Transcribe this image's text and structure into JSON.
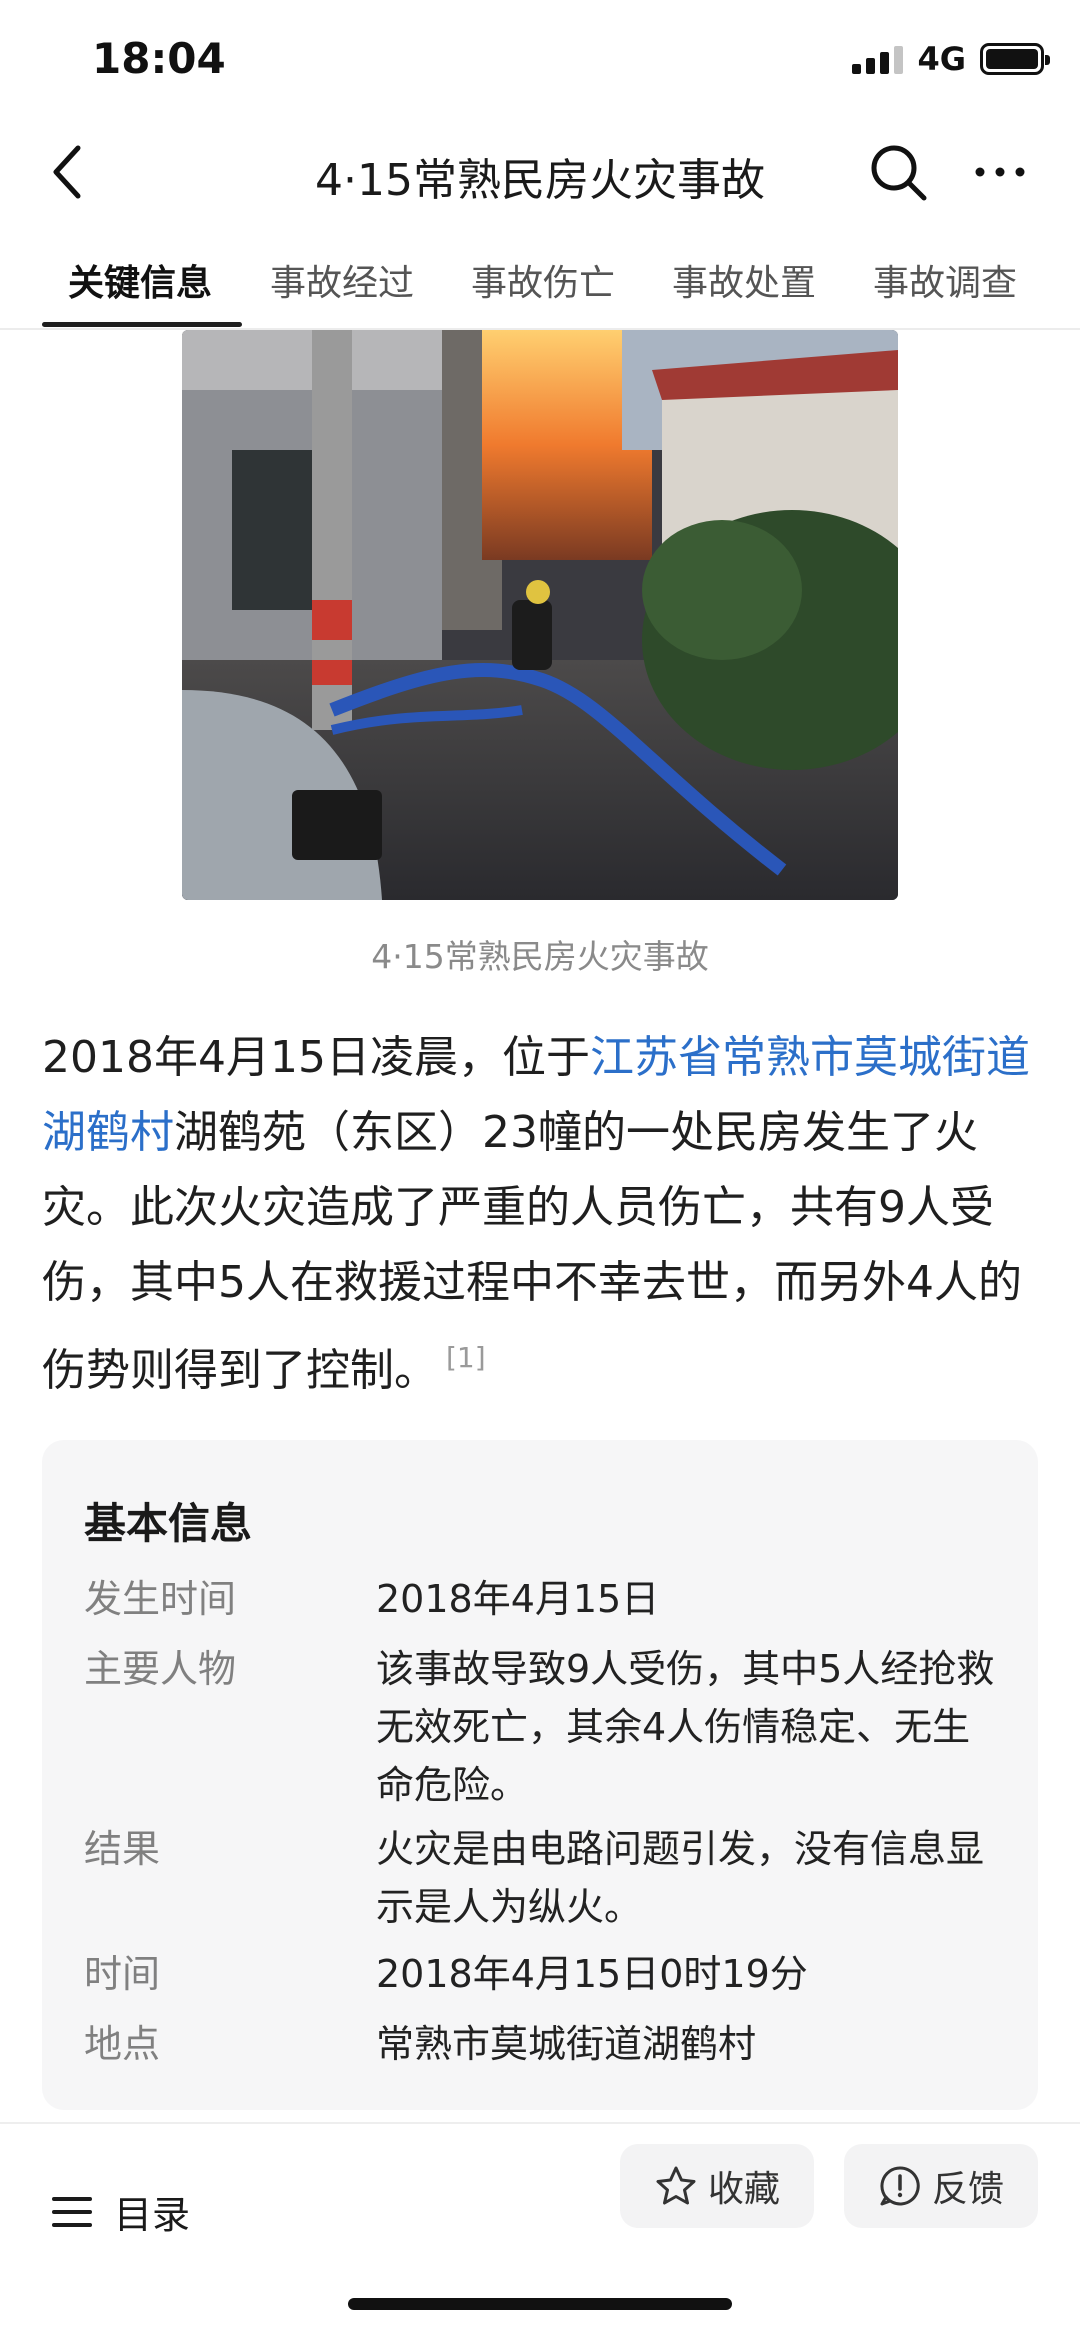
{
  "status": {
    "time": "18:04",
    "network": "4G"
  },
  "nav": {
    "title": "4·15常熟民房火灾事故",
    "tabs": [
      {
        "label": "关键信息",
        "active": true
      },
      {
        "label": "事故经过"
      },
      {
        "label": "事故伤亡"
      },
      {
        "label": "事故处置"
      },
      {
        "label": "事故调查"
      }
    ]
  },
  "image": {
    "caption": "4·15常熟民房火灾事故"
  },
  "intro": {
    "part1": "2018年4月15日凌晨，位于",
    "link": "江苏省常熟市莫城街道湖鹤村",
    "part2": "湖鹤苑（东区）23幢的一处民房发生了火灾。此次火灾造成了严重的人员伤亡，共有9人受伤，其中5人在救援过程中不幸去世，而另外4人的伤势则得到了控制。",
    "ref": "[1]"
  },
  "info": {
    "title": "基本信息",
    "rows": [
      {
        "key": "发生时间",
        "value": "2018年4月15日"
      },
      {
        "key": "主要人物",
        "value": "该事故导致9人受伤，其中5人经抢救无效死亡，其余4人伤情稳定、无生命危险。"
      },
      {
        "key": "结果",
        "value": "火灾是由电路问题引发，没有信息显示是人为纵火。"
      },
      {
        "key": "时间",
        "value": "2018年4月15日0时19分"
      },
      {
        "key": "地点",
        "value": "常熟市莫城街道湖鹤村"
      }
    ]
  },
  "bottom": {
    "toc": "目录",
    "favorite": "收藏",
    "feedback": "反馈"
  },
  "colors": {
    "link": "#2b6fc9",
    "card_bg": "#f6f6f7",
    "text": "#1f1f1f"
  },
  "icons": [
    "back-arrow-icon",
    "search-icon",
    "more-icon",
    "menu-icon",
    "star-icon",
    "feedback-icon"
  ]
}
